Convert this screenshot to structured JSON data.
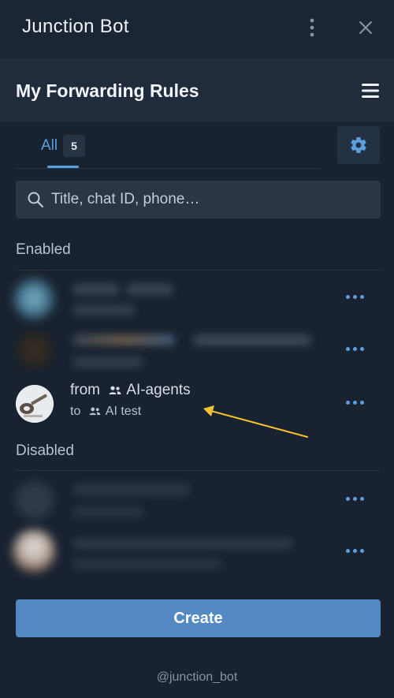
{
  "window": {
    "title": "Junction Bot",
    "menu_icon": "kebab-vertical-icon",
    "close_icon": "close-icon"
  },
  "header": {
    "title": "My Forwarding Rules",
    "menu_icon": "hamburger-menu-icon"
  },
  "tabs": [
    {
      "label": "All",
      "count": "5",
      "active": true
    }
  ],
  "settings_icon": "gear-icon",
  "search": {
    "placeholder": "Title, chat ID, phone…",
    "value": "",
    "icon": "search-icon"
  },
  "sections": {
    "enabled_label": "Enabled",
    "disabled_label": "Disabled"
  },
  "rules": {
    "visible_rule": {
      "from_prefix": "from",
      "from_chat": "AI-agents",
      "to_prefix": "to",
      "to_chat": "AI test"
    }
  },
  "actions": {
    "create_label": "Create"
  },
  "footer": {
    "handle": "@junction_bot"
  },
  "colors": {
    "accent": "#5c9fe0",
    "primary_button": "#5289c3",
    "background": "#182230",
    "annotation_arrow": "#f2c230"
  }
}
